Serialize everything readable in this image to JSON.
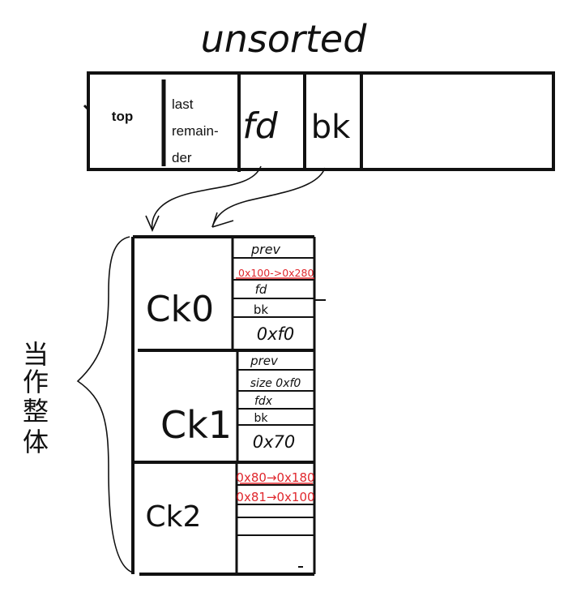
{
  "title": "unsorted",
  "bin": {
    "cells": [
      "top",
      "last",
      "remain-",
      "der",
      "fd",
      "bk"
    ]
  },
  "chunks": [
    {
      "name": "Ck0",
      "fields": [
        "prev",
        "0x100->0x280",
        "fd",
        "bk",
        "0xf0"
      ]
    },
    {
      "name": "Ck1",
      "fields": [
        "prev",
        "size 0xf0",
        "fdx",
        "bk",
        "0x70"
      ]
    },
    {
      "name": "Ck2",
      "fields": [
        "0x80→0x180",
        "0x81→0x100",
        "",
        ""
      ]
    }
  ],
  "side_label": [
    "当",
    "作",
    "整",
    "体"
  ],
  "colors": {
    "ink": "#111111",
    "red": "#e0282e"
  }
}
